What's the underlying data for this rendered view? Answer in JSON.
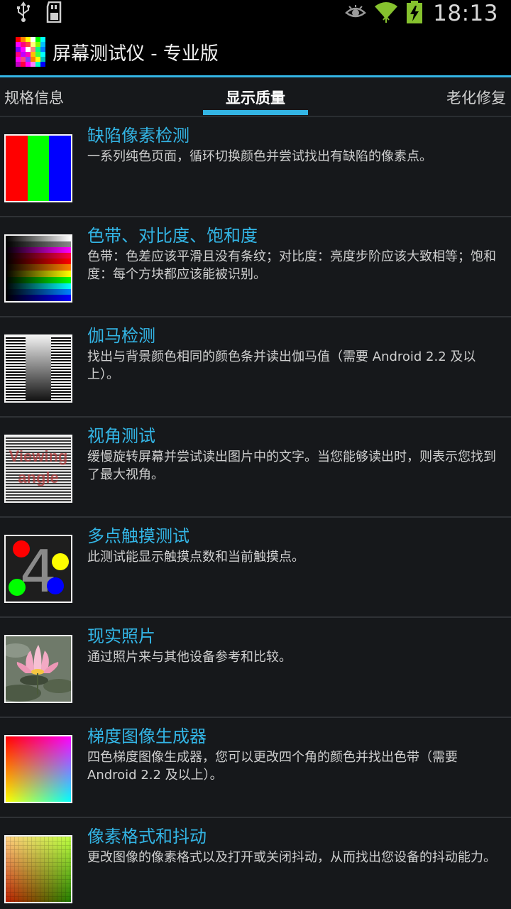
{
  "status_bar": {
    "time": "18:13",
    "icons": [
      "usb-icon",
      "sd-card-icon",
      "eye-icon",
      "wifi-icon",
      "battery-charging-icon"
    ]
  },
  "action_bar": {
    "title": "屏幕测试仪 - 专业版",
    "accent_color": "#33b5e5"
  },
  "tabs": [
    {
      "label": "规格信息",
      "selected": false
    },
    {
      "label": "显示质量",
      "selected": true
    },
    {
      "label": "老化修复",
      "selected": false
    }
  ],
  "items": [
    {
      "title": "缺陷像素检测",
      "description": "一系列纯色页面，循环切换颜色并尝试找出有缺陷的像素点。",
      "icon": "rgb-bars-thumbnail"
    },
    {
      "title": "色带、对比度、饱和度",
      "description": "色带：色差应该平滑且没有条纹；对比度：亮度步阶应该大致相等；饱和度：每个方块都应该能被识别。",
      "icon": "color-banding-thumbnail"
    },
    {
      "title": "伽马检测",
      "description": "找出与背景颜色相同的颜色条并读出伽马值（需要 Android 2.2 及以上）。",
      "icon": "gamma-thumbnail"
    },
    {
      "title": "视角测试",
      "description": "缓慢旋转屏幕并尝试读出图片中的文字。当您能够读出时，则表示您找到了最大视角。",
      "icon": "viewing-angle-thumbnail",
      "thumb_text": [
        "Viewing",
        "angle"
      ]
    },
    {
      "title": "多点触摸测试",
      "description": "此测试能显示触摸点数和当前触摸点。",
      "icon": "multitouch-thumbnail",
      "thumb_text": [
        "4"
      ]
    },
    {
      "title": "现实照片",
      "description": "通过照片来与其他设备参考和比较。",
      "icon": "lotus-photo-thumbnail"
    },
    {
      "title": "梯度图像生成器",
      "description": "四色梯度图像生成器，您可以更改四个角的颜色并找出色带（需要 Android 2.2 及以上）。",
      "icon": "gradient-thumbnail"
    },
    {
      "title": "像素格式和抖动",
      "description": "更改图像的像素格式以及打开或关闭抖动，从而找出您设备的抖动能力。",
      "icon": "dithering-thumbnail"
    }
  ]
}
